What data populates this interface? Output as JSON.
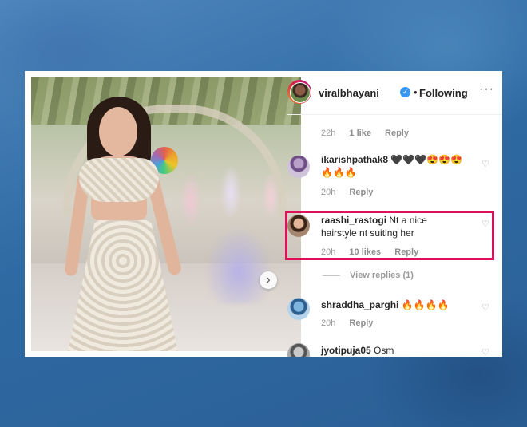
{
  "post": {
    "username": "viralbhayani",
    "dot": "•",
    "follow_label": "Following",
    "more_label": "···",
    "verified_glyph": "✓",
    "next_glyph": "›"
  },
  "top_meta": {
    "time": "22h",
    "likes": "1 like",
    "reply": "Reply"
  },
  "comments": [
    {
      "username": "ikarishpathak8",
      "text": "🖤🖤🖤😍😍😍🔥🔥🔥",
      "time": "20h",
      "reply": "Reply"
    },
    {
      "username": "raashi_rastogi",
      "text": "Nt a nice hairstyle nt suiting her",
      "time": "20h",
      "likes": "10 likes",
      "reply": "Reply"
    },
    {
      "username": "shraddha_parghi",
      "text": "🔥🔥🔥🔥",
      "time": "20h",
      "reply": "Reply"
    },
    {
      "username": "jyotipuja05",
      "text": "Osm"
    }
  ],
  "view_replies": "View replies (1)",
  "icons": {
    "heart": "heart-icon",
    "verified": "verified-badge-icon",
    "next": "chevron-right-icon"
  },
  "colors": {
    "highlight": "#e0105b",
    "verified": "#3897f0"
  }
}
